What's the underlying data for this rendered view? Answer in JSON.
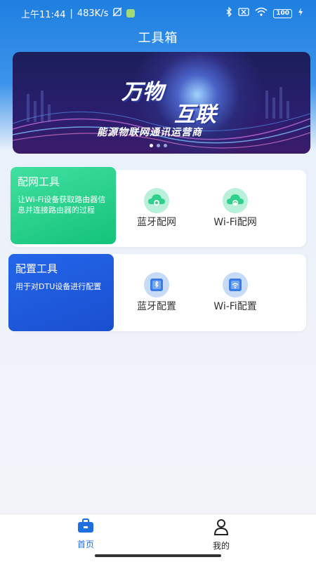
{
  "status_bar": {
    "time": "上午11:44",
    "speed": "483K/s",
    "battery": "100"
  },
  "header": {
    "title": "工具箱"
  },
  "banner": {
    "line1": "万物",
    "line2": "互联",
    "subtitle": "能源物联网通讯运营商",
    "page_count": 3,
    "active_page": 1
  },
  "cards": [
    {
      "title": "配网工具",
      "description": "让Wi-Fi设备获取路由器信息并连接路由器的过程",
      "options": [
        {
          "label": "蓝牙配网",
          "icon": "cloud-bluetooth-icon"
        },
        {
          "label": "Wi-Fi配网",
          "icon": "cloud-wifi-icon"
        }
      ],
      "accent": "#1ec986"
    },
    {
      "title": "配置工具",
      "description": "用于对DTU设备进行配置",
      "options": [
        {
          "label": "蓝牙配置",
          "icon": "device-bluetooth-icon"
        },
        {
          "label": "Wi-Fi配置",
          "icon": "device-wifi-icon"
        }
      ],
      "accent": "#1f5ce0"
    }
  ],
  "bottom_nav": {
    "items": [
      {
        "label": "首页",
        "icon": "toolbox-icon",
        "active": true
      },
      {
        "label": "我的",
        "icon": "user-icon",
        "active": false
      }
    ],
    "active_color": "#1f6fe0"
  }
}
